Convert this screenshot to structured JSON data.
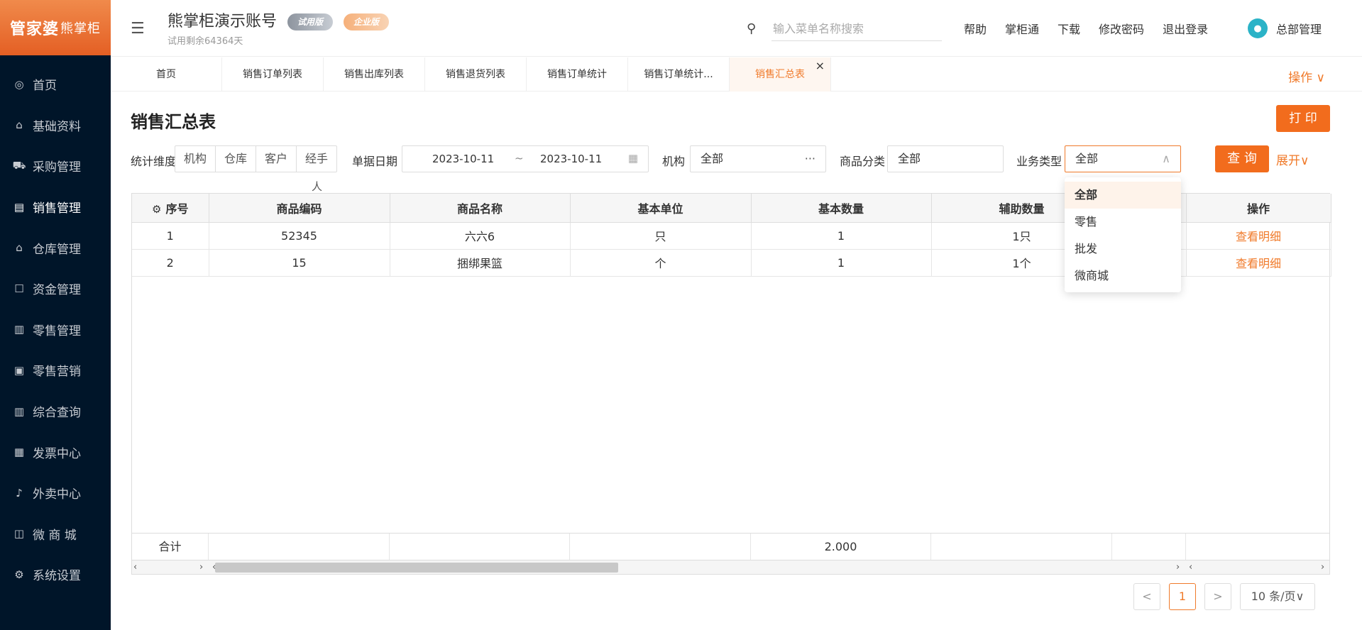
{
  "sidebar": {
    "logo_main": "管家婆",
    "logo_sub": "熊掌柜",
    "items": [
      {
        "label": "首页",
        "icon": "globe-icon",
        "glyph": "◎"
      },
      {
        "label": "基础资料",
        "icon": "home-icon",
        "glyph": "⌂"
      },
      {
        "label": "采购管理",
        "icon": "cart-icon",
        "glyph": "⛟"
      },
      {
        "label": "销售管理",
        "icon": "card-icon",
        "glyph": "▤"
      },
      {
        "label": "仓库管理",
        "icon": "warehouse-icon",
        "glyph": "⌂"
      },
      {
        "label": "资金管理",
        "icon": "wallet-icon",
        "glyph": "☐"
      },
      {
        "label": "零售管理",
        "icon": "chart-icon",
        "glyph": "▥"
      },
      {
        "label": "零售营销",
        "icon": "gift-icon",
        "glyph": "▣"
      },
      {
        "label": "综合查询",
        "icon": "bar-chart-icon",
        "glyph": "▥"
      },
      {
        "label": "发票中心",
        "icon": "invoice-icon",
        "glyph": "▦"
      },
      {
        "label": "外卖中心",
        "icon": "bell-icon",
        "glyph": "♪"
      },
      {
        "label": "微 商 城",
        "icon": "bag-icon",
        "glyph": "◫"
      },
      {
        "label": "系统设置",
        "icon": "gear-icon",
        "glyph": "⚙"
      }
    ]
  },
  "header": {
    "account_name": "熊掌柜演示账号",
    "badge_trial": "试用版",
    "badge_enterprise": "企业版",
    "trial_days": "试用剩余64364天",
    "search_placeholder": "输入菜单名称搜索",
    "links": [
      "帮助",
      "掌柜通",
      "下载",
      "修改密码",
      "退出登录"
    ],
    "user_name": "总部管理"
  },
  "tabs": [
    "首页",
    "销售订单列表",
    "销售出库列表",
    "销售退货列表",
    "销售订单统计",
    "销售订单统计...",
    "销售汇总表"
  ],
  "tabs_ops": "操作",
  "page": {
    "title": "销售汇总表",
    "print_label": "打 印"
  },
  "filters": {
    "dimension_label": "统计维度",
    "dimension_options": [
      "机构",
      "仓库",
      "客户",
      "经手"
    ],
    "dimension_overflow": "人",
    "date_label": "单据日期",
    "date_from": "2023-10-11",
    "date_sep": "~",
    "date_to": "2023-10-11",
    "org_label": "机构",
    "org_value": "全部",
    "category_label": "商品分类",
    "category_value": "全部",
    "biz_label": "业务类型",
    "biz_value": "全部",
    "query_label": "查 询",
    "expand_label": "展开"
  },
  "dropdown": {
    "options": [
      "全部",
      "零售",
      "批发",
      "微商城"
    ],
    "selected": "全部"
  },
  "table": {
    "columns": [
      "序号",
      "商品编码",
      "商品名称",
      "基本单位",
      "基本数量",
      "辅助数量",
      "",
      "操作"
    ],
    "rows": [
      {
        "no": "1",
        "code": "52345",
        "name": "六六6",
        "unit": "只",
        "qty": "1",
        "aux_qty": "1只",
        "action": "查看明细"
      },
      {
        "no": "2",
        "code": "15",
        "name": "捆绑果篮",
        "unit": "个",
        "qty": "1",
        "aux_qty": "1个",
        "action": "查看明细"
      }
    ],
    "sum_label": "合计",
    "sum_qty": "2.000"
  },
  "pagination": {
    "prev": "<",
    "current": "1",
    "next": ">",
    "page_size": "10 条/页"
  }
}
